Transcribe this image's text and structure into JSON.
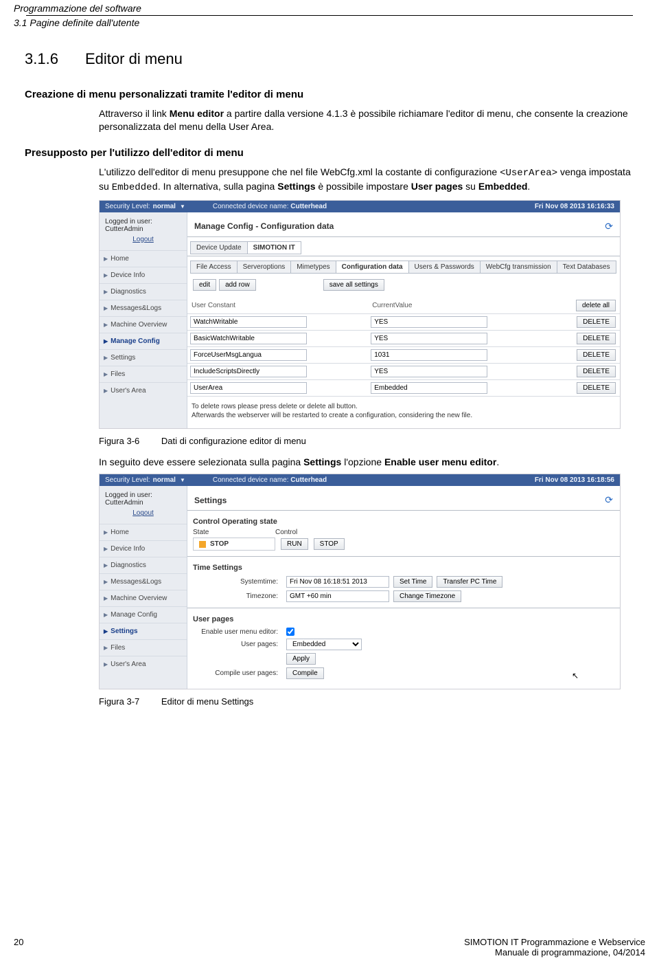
{
  "page_header": {
    "line1": "Programmazione del software",
    "line2": "3.1 Pagine definite dall'utente"
  },
  "section": {
    "num": "3.1.6",
    "title": "Editor di menu"
  },
  "h1": "Creazione di menu personalizzati tramite l'editor di menu",
  "p1a": "Attraverso il link ",
  "p1b": "Menu editor",
  "p1c": " a partire dalla versione 4.1.3 è possibile richiamare l'editor di menu, che consente la creazione personalizzata del menu della User Area.",
  "h2": "Presupposto per l'utilizzo dell'editor di menu",
  "p2a": "L'utilizzo dell'editor di menu presuppone che nel file WebCfg.xml la costante di configurazione ",
  "p2b": "<UserArea>",
  "p2c": " venga impostata su ",
  "p2d": "Embedded",
  "p2e": ". In alternativa, sulla pagina ",
  "p2f": "Settings",
  "p2g": " è possibile impostare ",
  "p2h": "User pages",
  "p2i": " su ",
  "p2j": "Embedded",
  "p2k": ".",
  "ui1": {
    "security_label": "Security Level:",
    "security_value": "normal",
    "device_label": "Connected device name:",
    "device_value": "Cutterhead",
    "timestamp": "Fri Nov 08 2013  16:16:33",
    "logged_in": "Logged in user: CutterAdmin",
    "logout": "Logout",
    "nav": [
      "Home",
      "Device Info",
      "Diagnostics",
      "Messages&Logs",
      "Machine Overview",
      "Manage Config",
      "Settings",
      "Files",
      "User's Area"
    ],
    "nav_active": "Manage Config",
    "title": "Manage Config - Configuration data",
    "tabs_top": [
      "Device Update",
      "SIMOTION IT"
    ],
    "tabs_top_active": "SIMOTION IT",
    "tabs_sub": [
      "File Access",
      "Serveroptions",
      "Mimetypes",
      "Configuration data",
      "Users & Passwords",
      "WebCfg transmission",
      "Text Databases"
    ],
    "tabs_sub_active": "Configuration data",
    "btn_edit": "edit",
    "btn_addrow": "add row",
    "btn_saveall": "save all settings",
    "col1": "User Constant",
    "col2": "CurrentValue",
    "btn_deleteall": "delete all",
    "btn_delete": "DELETE",
    "rows": [
      {
        "k": "WatchWritable",
        "v": "YES"
      },
      {
        "k": "BasicWatchWritable",
        "v": "YES"
      },
      {
        "k": "ForceUserMsgLangua",
        "v": "1031"
      },
      {
        "k": "IncludeScriptsDirectly",
        "v": "YES"
      },
      {
        "k": "UserArea",
        "v": "Embedded"
      }
    ],
    "hint1": "To delete rows please press delete or delete all button.",
    "hint2": "Afterwards the webserver will be restarted to create a configuration, considering the new file."
  },
  "fig1_lbl": "Figura 3-6",
  "fig1_txt": "Dati di configurazione editor di menu",
  "p3a": "In seguito deve essere selezionata sulla pagina ",
  "p3b": "Settings",
  "p3c": " l'opzione ",
  "p3d": "Enable user menu editor",
  "p3e": ".",
  "ui2": {
    "security_label": "Security Level:",
    "security_value": "normal",
    "device_label": "Connected device name:",
    "device_value": "Cutterhead",
    "timestamp": "Fri Nov 08 2013  16:18:56",
    "logged_in": "Logged in user: CutterAdmin",
    "logout": "Logout",
    "nav": [
      "Home",
      "Device Info",
      "Diagnostics",
      "Messages&Logs",
      "Machine Overview",
      "Manage Config",
      "Settings",
      "Files",
      "User's Area"
    ],
    "nav_active": "Settings",
    "title": "Settings",
    "panel1": "Control Operating state",
    "state_h": "State",
    "control_h": "Control",
    "state_val": "STOP",
    "btn_run": "RUN",
    "btn_stop": "STOP",
    "panel2": "Time Settings",
    "systime_lbl": "Systemtime:",
    "systime_val": "Fri Nov 08 16:18:51 2013",
    "btn_settime": "Set Time",
    "btn_transfer": "Transfer PC Time",
    "tz_lbl": "Timezone:",
    "tz_val": "GMT +60 min",
    "btn_changetz": "Change Timezone",
    "panel3": "User pages",
    "enable_lbl": "Enable user menu editor:",
    "userpages_lbl": "User pages:",
    "userpages_val": "Embedded",
    "btn_apply": "Apply",
    "compile_lbl": "Compile user pages:",
    "btn_compile": "Compile"
  },
  "fig2_lbl": "Figura 3-7",
  "fig2_txt": "Editor di menu Settings",
  "footer": {
    "page": "20",
    "r1": "SIMOTION IT Programmazione e Webservice",
    "r2": "Manuale di programmazione, 04/2014"
  }
}
